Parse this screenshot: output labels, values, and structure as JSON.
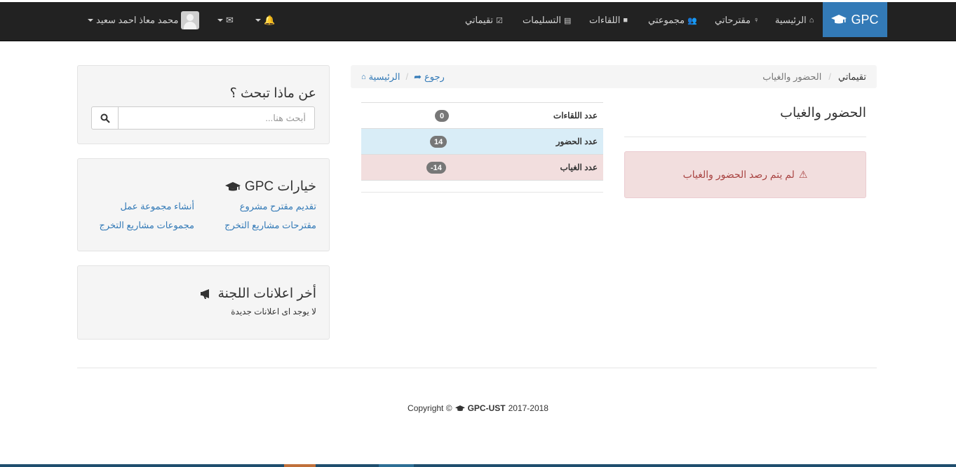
{
  "navbar": {
    "brand": "GPC",
    "links": [
      {
        "label": "الرئيسية",
        "icon": "home-icon"
      },
      {
        "label": "مقترحاتي",
        "icon": "lightbulb-icon"
      },
      {
        "label": "مجموعتي",
        "icon": "users-icon"
      },
      {
        "label": "اللقاءات",
        "icon": "video-icon"
      },
      {
        "label": "التسليمات",
        "icon": "book-icon"
      },
      {
        "label": "تقيماتي",
        "icon": "check-square-icon"
      }
    ],
    "user_name": "محمد معاذ احمد سعيد"
  },
  "breadcrumb": {
    "root": "تقيماتي",
    "current": "الحضور والغياب",
    "back_label": "رجوع",
    "home_label": "الرئيسية"
  },
  "main": {
    "title": "الحضور والغياب",
    "alert": "لم يتم رصد الحضور والغياب",
    "stats": [
      {
        "label": "عدد اللقاءات",
        "value": "0"
      },
      {
        "label": "عدد الحضور",
        "value": "14"
      },
      {
        "label": "عدد الغياب",
        "value": "-14"
      }
    ]
  },
  "sidebar": {
    "search": {
      "title": "عن ماذا تبحث ؟",
      "placeholder": "أبحث هنا..."
    },
    "options": {
      "title": "خيارات GPC",
      "links": [
        "تقديم مقترح مشروع",
        "أنشاء مجموعة عمل",
        "مقترحات مشاريع التخرج",
        "مجموعات مشاريع التخرج"
      ]
    },
    "announcements": {
      "title": "أخر اعلانات اللجنة",
      "empty": "لا يوجد اى اعلانات جديدة"
    }
  },
  "footer": {
    "prefix": "Copyright ©",
    "brand": "GPC-UST",
    "years": "2017-2018"
  },
  "colors": {
    "navbar": "#222222",
    "brand": "#337ab7",
    "link": "#337ab7",
    "danger_bg": "#f2dede",
    "info_bg": "#d9edf7"
  }
}
